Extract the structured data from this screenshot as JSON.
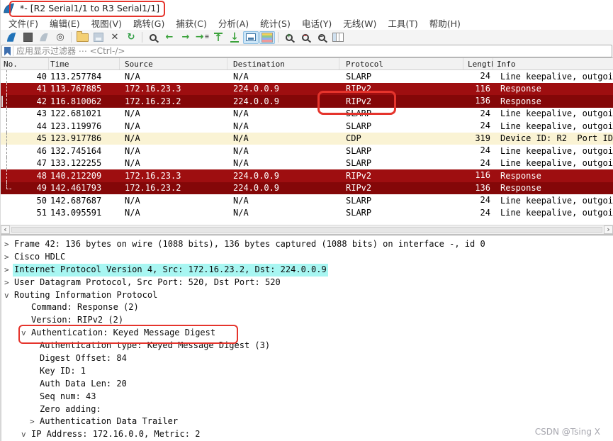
{
  "window": {
    "title": "*- [R2 Serial1/1 to R3 Serial1/1]",
    "watermark": "CSDN @Tsing X"
  },
  "menu": {
    "items": [
      "文件(F)",
      "编辑(E)",
      "视图(V)",
      "跳转(G)",
      "捕获(C)",
      "分析(A)",
      "统计(S)",
      "电话(Y)",
      "无线(W)",
      "工具(T)",
      "帮助(H)"
    ]
  },
  "toolbar": {
    "items": [
      {
        "name": "start-capture",
        "kind": "fin"
      },
      {
        "name": "stop-capture",
        "kind": "stop"
      },
      {
        "name": "restart-capture",
        "kind": "fin-gray"
      },
      {
        "name": "capture-options",
        "kind": "glyph",
        "glyph": "◎",
        "color": "#454545"
      },
      {
        "sep": true
      },
      {
        "name": "open-capture-file",
        "kind": "folder"
      },
      {
        "name": "save-capture-file",
        "kind": "save"
      },
      {
        "name": "close-capture-file",
        "kind": "glyph",
        "glyph": "✕",
        "color": "#3c3c3c"
      },
      {
        "name": "reload-capture-file",
        "kind": "glyph",
        "glyph": "↻",
        "color": "#2f9e44"
      },
      {
        "sep": true
      },
      {
        "name": "find-packet",
        "kind": "mag"
      },
      {
        "name": "go-back",
        "kind": "glyph",
        "glyph": "←",
        "color": "#3ba23b"
      },
      {
        "name": "go-forward",
        "kind": "glyph",
        "glyph": "→",
        "color": "#3ba23b"
      },
      {
        "name": "go-to-packet",
        "kind": "goto",
        "glyph": "→",
        "color": "#3ba23b"
      },
      {
        "name": "go-to-top",
        "kind": "glyph-top",
        "glyph": "↑",
        "color": "#3ba23b"
      },
      {
        "name": "go-to-bottom",
        "kind": "glyph-bottom",
        "glyph": "↓",
        "color": "#3ba23b"
      },
      {
        "name": "auto-scroll",
        "kind": "autoscroll",
        "pressed": true
      },
      {
        "name": "colorize-packets",
        "kind": "colorize",
        "pressed": true
      },
      {
        "sep": true
      },
      {
        "name": "zoom-in",
        "kind": "mag-plus"
      },
      {
        "name": "zoom-out",
        "kind": "mag-minus"
      },
      {
        "name": "zoom-reset",
        "kind": "mag-reset"
      },
      {
        "name": "resize-columns",
        "kind": "columns"
      }
    ]
  },
  "filter": {
    "placeholder": "应用显示过滤器 ⋯ <Ctrl-/>"
  },
  "packet_list": {
    "columns": [
      "No.",
      "Time",
      "Source",
      "Destination",
      "Protocol",
      "Length",
      "Info"
    ],
    "rows": [
      {
        "no": "40",
        "time": "113.257784",
        "source": "N/A",
        "destination": "N/A",
        "protocol": "SLARP",
        "length": "24",
        "info": "Line keepalive, outgoi",
        "style": "default",
        "marker": "line"
      },
      {
        "no": "41",
        "time": "113.767885",
        "source": "172.16.23.3",
        "destination": "224.0.0.9",
        "protocol": "RIPv2",
        "length": "116",
        "info": "Response",
        "style": "rip-light",
        "marker": "line"
      },
      {
        "no": "42",
        "time": "116.810062",
        "source": "172.16.23.2",
        "destination": "224.0.0.9",
        "protocol": "RIPv2",
        "length": "136",
        "info": "Response",
        "style": "rip-dark",
        "marker": "line",
        "selected": true
      },
      {
        "no": "43",
        "time": "122.681021",
        "source": "N/A",
        "destination": "N/A",
        "protocol": "SLARP",
        "length": "24",
        "info": "Line keepalive, outgoi",
        "style": "default",
        "marker": "line"
      },
      {
        "no": "44",
        "time": "123.119976",
        "source": "N/A",
        "destination": "N/A",
        "protocol": "SLARP",
        "length": "24",
        "info": "Line keepalive, outgoi",
        "style": "default",
        "marker": "line"
      },
      {
        "no": "45",
        "time": "123.917786",
        "source": "N/A",
        "destination": "N/A",
        "protocol": "CDP",
        "length": "319",
        "info": "Device ID: R2  Port ID",
        "style": "cdp",
        "marker": "line"
      },
      {
        "no": "46",
        "time": "132.745164",
        "source": "N/A",
        "destination": "N/A",
        "protocol": "SLARP",
        "length": "24",
        "info": "Line keepalive, outgoi",
        "style": "default",
        "marker": "line"
      },
      {
        "no": "47",
        "time": "133.122255",
        "source": "N/A",
        "destination": "N/A",
        "protocol": "SLARP",
        "length": "24",
        "info": "Line keepalive, outgoi",
        "style": "default",
        "marker": "line"
      },
      {
        "no": "48",
        "time": "140.212209",
        "source": "172.16.23.3",
        "destination": "224.0.0.9",
        "protocol": "RIPv2",
        "length": "116",
        "info": "Response",
        "style": "rip-light",
        "marker": "line"
      },
      {
        "no": "49",
        "time": "142.461793",
        "source": "172.16.23.2",
        "destination": "224.0.0.9",
        "protocol": "RIPv2",
        "length": "136",
        "info": "Response",
        "style": "rip-dark",
        "marker": "corner"
      },
      {
        "no": "50",
        "time": "142.687687",
        "source": "N/A",
        "destination": "N/A",
        "protocol": "SLARP",
        "length": "24",
        "info": "Line keepalive, outgoi",
        "style": "default",
        "marker": "none"
      },
      {
        "no": "51",
        "time": "143.095591",
        "source": "N/A",
        "destination": "N/A",
        "protocol": "SLARP",
        "length": "24",
        "info": "Line keepalive, outgoi",
        "style": "default",
        "marker": "none"
      }
    ]
  },
  "scrollbar": {
    "left_arrow": "‹",
    "right_arrow": "›"
  },
  "details": {
    "lines": [
      {
        "indent": 0,
        "expander": ">",
        "text": "Frame 42: 136 bytes on wire (1088 bits), 136 bytes captured (1088 bits) on interface -, id 0"
      },
      {
        "indent": 0,
        "expander": ">",
        "text": "Cisco HDLC"
      },
      {
        "indent": 0,
        "expander": ">",
        "text": "Internet Protocol Version 4, Src: 172.16.23.2, Dst: 224.0.0.9",
        "highlight": true
      },
      {
        "indent": 0,
        "expander": ">",
        "text": "User Datagram Protocol, Src Port: 520, Dst Port: 520"
      },
      {
        "indent": 0,
        "expander": "v",
        "text": "Routing Information Protocol"
      },
      {
        "indent": 1,
        "expander": "",
        "text": "Command: Response (2)"
      },
      {
        "indent": 1,
        "expander": "",
        "text": "Version: RIPv2 (2)"
      },
      {
        "indent": 1,
        "expander": "v",
        "text": "Authentication: Keyed Message Digest",
        "boxed": true
      },
      {
        "indent": 2,
        "expander": "",
        "text": "Authentication type: Keyed Message Digest (3)"
      },
      {
        "indent": 2,
        "expander": "",
        "text": "Digest Offset: 84"
      },
      {
        "indent": 2,
        "expander": "",
        "text": "Key ID: 1"
      },
      {
        "indent": 2,
        "expander": "",
        "text": "Auth Data Len: 20"
      },
      {
        "indent": 2,
        "expander": "",
        "text": "Seq num: 43"
      },
      {
        "indent": 2,
        "expander": "",
        "text": "Zero adding:"
      },
      {
        "indent": 2,
        "expander": ">",
        "text": "Authentication Data Trailer"
      },
      {
        "indent": 1,
        "expander": "v",
        "text": "IP Address: 172.16.0.0, Metric: 2"
      }
    ]
  },
  "colors": {
    "rip_light": "#9e0e10",
    "rip_dark": "#840708",
    "cdp_row": "#faf3d4",
    "ip_highlight": "#a8f6f2",
    "annotation": "#e5342c"
  }
}
